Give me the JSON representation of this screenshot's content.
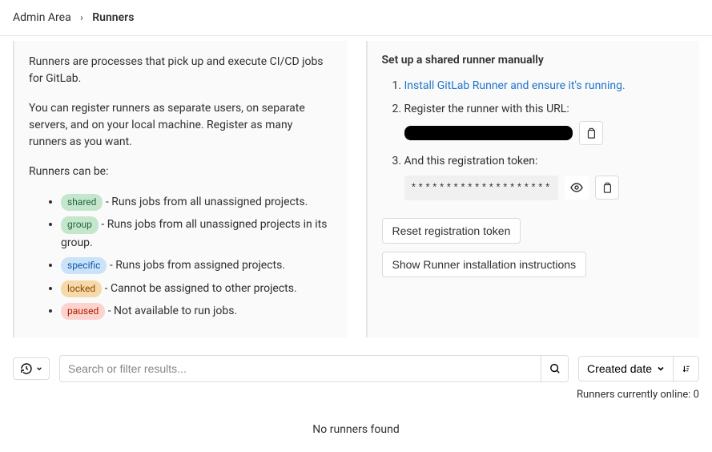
{
  "breadcrumb": {
    "parent": "Admin Area",
    "current": "Runners"
  },
  "info": {
    "p1": "Runners are processes that pick up and execute CI/CD jobs for GitLab.",
    "p2": "You can register runners as separate users, on separate servers, and on your local machine. Register as many runners as you want.",
    "p3": "Runners can be:",
    "types": [
      {
        "badge": "shared",
        "cls": "badge-shared",
        "desc": " - Runs jobs from all unassigned projects."
      },
      {
        "badge": "group",
        "cls": "badge-group",
        "desc": " - Runs jobs from all unassigned projects in its group."
      },
      {
        "badge": "specific",
        "cls": "badge-specific",
        "desc": " - Runs jobs from assigned projects."
      },
      {
        "badge": "locked",
        "cls": "badge-locked",
        "desc": " - Cannot be assigned to other projects."
      },
      {
        "badge": "paused",
        "cls": "badge-paused",
        "desc": " - Not available to run jobs."
      }
    ]
  },
  "setup": {
    "title": "Set up a shared runner manually",
    "step1_link": "Install GitLab Runner and ensure it's running.",
    "step2": "Register the runner with this URL:",
    "step3": "And this registration token:",
    "token_masked": "********************",
    "reset_btn": "Reset registration token",
    "instructions_btn": "Show Runner installation instructions"
  },
  "search": {
    "placeholder": "Search or filter results..."
  },
  "sort": {
    "label": "Created date"
  },
  "online": "Runners currently online: 0",
  "empty": "No runners found"
}
